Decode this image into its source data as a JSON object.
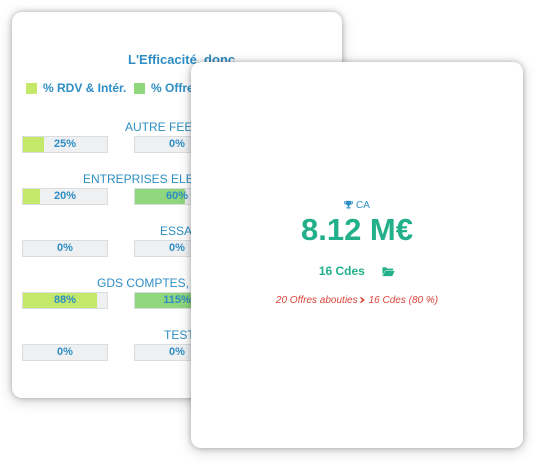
{
  "back_card": {
    "title": "L'Efficacité, donc",
    "legend": [
      {
        "label": "% RDV & Intér.",
        "color": "#c4e86a"
      },
      {
        "label": "% Offres",
        "color": "#8fd67c"
      }
    ],
    "rows": [
      {
        "label": "AUTRE FEE",
        "bar1_text": "25%",
        "bar1_fill": 0.25,
        "bar2_text": "0%",
        "bar2_fill": 0
      },
      {
        "label": "ENTREPRISES ELE",
        "bar1_text": "20%",
        "bar1_fill": 0.2,
        "bar2_text": "60%",
        "bar2_fill": 0.6
      },
      {
        "label": "ESSA",
        "bar1_text": "0%",
        "bar1_fill": 0,
        "bar2_text": "0%",
        "bar2_fill": 0
      },
      {
        "label": "GDS COMPTES,",
        "bar1_text": "88%",
        "bar1_fill": 0.88,
        "bar2_text": "115%",
        "bar2_fill": 1.0
      },
      {
        "label": "TEST",
        "bar1_text": "0%",
        "bar1_fill": 0,
        "bar2_text": "0%",
        "bar2_fill": 0
      }
    ]
  },
  "front_card": {
    "ca_label": "CA",
    "ca_icon": "trophy-icon",
    "ca_value": "8.12 M€",
    "cdes_text": "16 Cdes",
    "cdes_icon": "folder-open-icon",
    "offers_text": "20 Offres abouties",
    "offers_icon": "chevron-right-icon",
    "offers_result": "16 Cdes (80 %)"
  },
  "colors": {
    "blue": "#2e8ec4",
    "teal": "#21b08a",
    "red": "#d9453a",
    "bar1": "#c4e86a",
    "bar2": "#8fd67c"
  }
}
